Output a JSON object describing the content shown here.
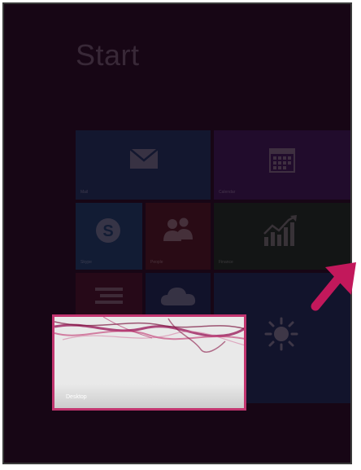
{
  "start": {
    "title": "Start"
  },
  "tiles": [
    {
      "id": "mail",
      "label": "Mail",
      "icon": "mail-icon"
    },
    {
      "id": "calendar",
      "label": "Calendar",
      "icon": "calendar-icon"
    },
    {
      "id": "skype",
      "label": "Skype",
      "icon": "skype-icon"
    },
    {
      "id": "people",
      "label": "People",
      "icon": "people-icon"
    },
    {
      "id": "finance",
      "label": "Finance",
      "icon": "finance-chart-icon"
    },
    {
      "id": "news",
      "label": "",
      "icon": "news-icon"
    },
    {
      "id": "onedrive",
      "label": "",
      "icon": "onedrive-cloud-icon"
    },
    {
      "id": "weather",
      "label": "",
      "icon": "weather-sun-icon"
    }
  ],
  "desktop_tile": {
    "label": "Desktop"
  },
  "colors": {
    "screen_bg": "#160a14",
    "highlight_border": "#c23670",
    "arrow": "#c2185b"
  }
}
